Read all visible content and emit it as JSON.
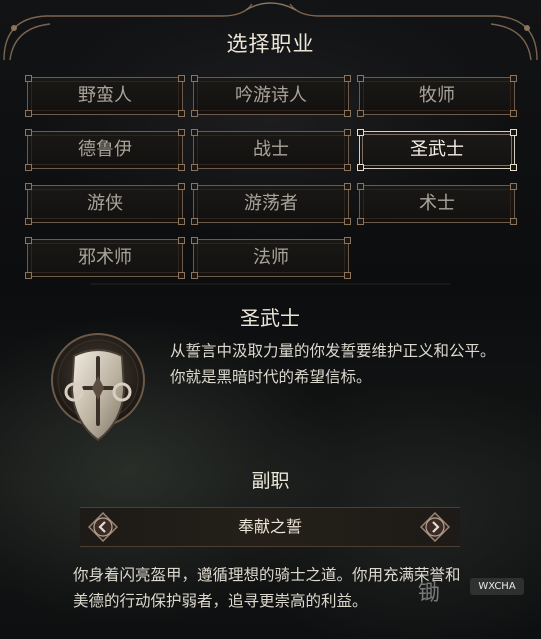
{
  "screen_title": "选择职业",
  "classes": [
    {
      "label": "野蛮人",
      "selected": false
    },
    {
      "label": "吟游诗人",
      "selected": false
    },
    {
      "label": "牧师",
      "selected": false
    },
    {
      "label": "德鲁伊",
      "selected": false
    },
    {
      "label": "战士",
      "selected": false
    },
    {
      "label": "圣武士",
      "selected": true
    },
    {
      "label": "游侠",
      "selected": false
    },
    {
      "label": "游荡者",
      "selected": false
    },
    {
      "label": "术士",
      "selected": false
    },
    {
      "label": "邪术师",
      "selected": false
    },
    {
      "label": "法师",
      "selected": false
    }
  ],
  "selected_class": {
    "name": "圣武士",
    "description": "从誓言中汲取力量的你发誓要维护正义和公平。你就是黑暗时代的希望信标。",
    "crest_icon": "paladin-shield-crest-icon"
  },
  "subclass": {
    "heading": "副职",
    "current": "奉献之誓",
    "prev_icon": "chevron-left-icon",
    "next_icon": "chevron-right-icon",
    "description": "你身着闪亮盔甲，遵循理想的骑士之道。你用充满荣誉和美德的行动保护弱者，追寻更崇高的利益。"
  },
  "watermark": {
    "badge": "WXCHA",
    "text": "锄"
  },
  "colors": {
    "frame": "#7a6450",
    "text_primary": "#ece6d8",
    "text_muted": "#a9a49a",
    "selected_border": "#d9cfbe"
  }
}
